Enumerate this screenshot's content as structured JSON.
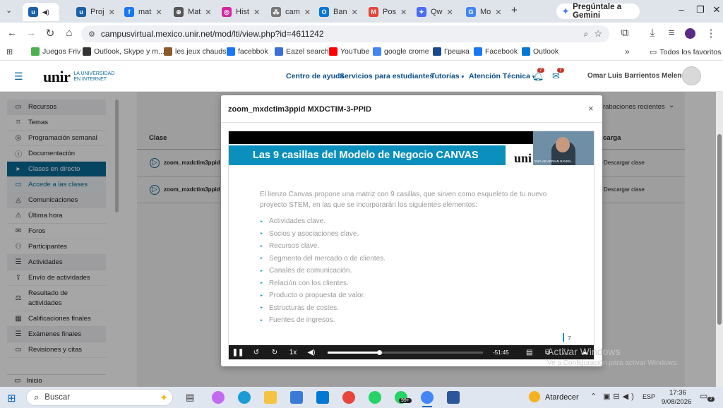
{
  "browser": {
    "tabs": [
      {
        "label": "",
        "color": "#1a5fa8",
        "letter": "u",
        "active": true
      },
      {
        "label": "Proj",
        "color": "#1a5fa8",
        "letter": "u"
      },
      {
        "label": "mat",
        "color": "#1877f2",
        "letter": "f"
      },
      {
        "label": "Mat",
        "color": "#555555",
        "letter": "⊕"
      },
      {
        "label": "Hist",
        "color": "#d6249f",
        "letter": "◎"
      },
      {
        "label": "cam",
        "color": "#777777",
        "letter": "⁂"
      },
      {
        "label": "Ban",
        "color": "#0078d4",
        "letter": "O"
      },
      {
        "label": "Pos",
        "color": "#ea4335",
        "letter": "M"
      },
      {
        "label": "Qw",
        "color": "#4a6cf7",
        "letter": "✦"
      },
      {
        "label": "Mo",
        "color": "#4285f4",
        "letter": "G"
      }
    ],
    "gemini_label": "Pregúntale a Gemini",
    "url": "campusvirtual.mexico.unir.net/mod/lti/view.php?id=4611242",
    "bookmarks": [
      {
        "label": "Juegos Friv",
        "color": "#4caf50"
      },
      {
        "label": "Outlook, Skype y m...",
        "color": "#333333"
      },
      {
        "label": "les jeux chauds",
        "color": "#8a5a2b"
      },
      {
        "label": "facebbok",
        "color": "#1877f2"
      },
      {
        "label": "Eazel search",
        "color": "#3b6ed6"
      },
      {
        "label": "YouTube",
        "color": "#ff0000"
      },
      {
        "label": "google crome",
        "color": "#4285f4"
      },
      {
        "label": "Грешка",
        "color": "#1a4a8a"
      },
      {
        "label": "Facebook",
        "color": "#1877f2"
      },
      {
        "label": "Outlook",
        "color": "#0078d4"
      }
    ],
    "all_favorites": "Todos los favoritos"
  },
  "site": {
    "logo": "unir",
    "logo_tagline_1": "LA UNIVERSIDAD",
    "logo_tagline_2": "EN INTERNET",
    "nav": {
      "help": "Centro de ayuda",
      "services": "Servicios para estudiantes",
      "tutorials": "Tutorías",
      "tech": "Atención Técnica"
    },
    "notif_count": "7",
    "msg_count": "7",
    "user_name": "Omar Luis Barrientos Melendez"
  },
  "sidebar": {
    "items": [
      {
        "label": "Recursos",
        "icon": "folder-icon",
        "glyph": "▭",
        "kind": "section"
      },
      {
        "label": "Temas",
        "icon": "bookmark-icon",
        "glyph": "⌑",
        "kind": "item"
      },
      {
        "label": "Programación semanal",
        "icon": "calendar-icon",
        "glyph": "◎",
        "kind": "item"
      },
      {
        "label": "Documentación",
        "icon": "info-icon",
        "glyph": "ⓘ",
        "kind": "item"
      },
      {
        "label": "Clases en directo",
        "icon": "video-icon",
        "glyph": "▸",
        "kind": "active"
      },
      {
        "label": "Accede a las clases",
        "icon": "folder-icon",
        "glyph": "▭",
        "kind": "sub"
      },
      {
        "label": "Comunicaciones",
        "icon": "megaphone-icon",
        "glyph": "◬",
        "kind": "section"
      },
      {
        "label": "Última hora",
        "icon": "alert-icon",
        "glyph": "⚠",
        "kind": "item"
      },
      {
        "label": "Foros",
        "icon": "chat-icon",
        "glyph": "✉",
        "kind": "item"
      },
      {
        "label": "Participantes",
        "icon": "people-icon",
        "glyph": "⚇",
        "kind": "item"
      },
      {
        "label": "Actividades",
        "icon": "list-icon",
        "glyph": "☰",
        "kind": "section"
      },
      {
        "label": "Envío de actividades",
        "icon": "upload-icon",
        "glyph": "⇪",
        "kind": "item"
      },
      {
        "label": "Resultado de actividades",
        "icon": "results-icon",
        "glyph": "⚖",
        "kind": "item2"
      },
      {
        "label": "Calificaciones finales",
        "icon": "grades-icon",
        "glyph": "▦",
        "kind": "item"
      },
      {
        "label": "Exámenes finales",
        "icon": "list-icon",
        "glyph": "☰",
        "kind": "section"
      },
      {
        "label": "Revisiones y citas",
        "icon": "calendar-icon",
        "glyph": "▭",
        "kind": "item"
      }
    ],
    "home_label": "Inicio"
  },
  "background_table": {
    "header_left": "Clase",
    "header_right": "carga",
    "recent_label": "rabaciones recientes",
    "rows": [
      {
        "name": "zoom_mxdctim3ppid M",
        "action": "Descargar clase"
      },
      {
        "name": "zoom_mxdctim3ppid M",
        "action": "Descargar clase"
      }
    ]
  },
  "modal": {
    "title": "zoom_mxdctim3ppid MXDCTIM-3-PPID",
    "close": "×",
    "slide": {
      "banner_title": "Las 9 casillas del Modelo de Negocio CANVAS",
      "brand": "uni",
      "intro": "El lienzo Canvas propone una matriz con 9 casillas, que sirven como esqueleto de tu nuevo proyecto STEM, en las que se incorporarán los siguientes elementos:",
      "bullets": [
        "Actividades clave.",
        "Socios y asociaciones clave.",
        "Recursos clave.",
        "Segmento del mercado o de clientes.",
        "Canales de comunicación.",
        "Relación con los clientes.",
        "Producto o propuesta de valor.",
        "Estructuras de costes.",
        "Fuentes de ingresos."
      ],
      "page_number": "7",
      "presenter_caption": "ENG AR ADRIAN RAVEN..."
    },
    "player": {
      "speed": "1x",
      "time_remaining": "-51:45",
      "progress": 0.33
    }
  },
  "watermark": {
    "line1": "Activar Windows",
    "line2": "Ve a Configuración para activar Windows."
  },
  "taskbar": {
    "search": "Buscar",
    "badge": "99+",
    "weather": "Atardecer",
    "lang": "ESP",
    "time": "17:36",
    "date": "9/08/2026",
    "notif": "2"
  }
}
